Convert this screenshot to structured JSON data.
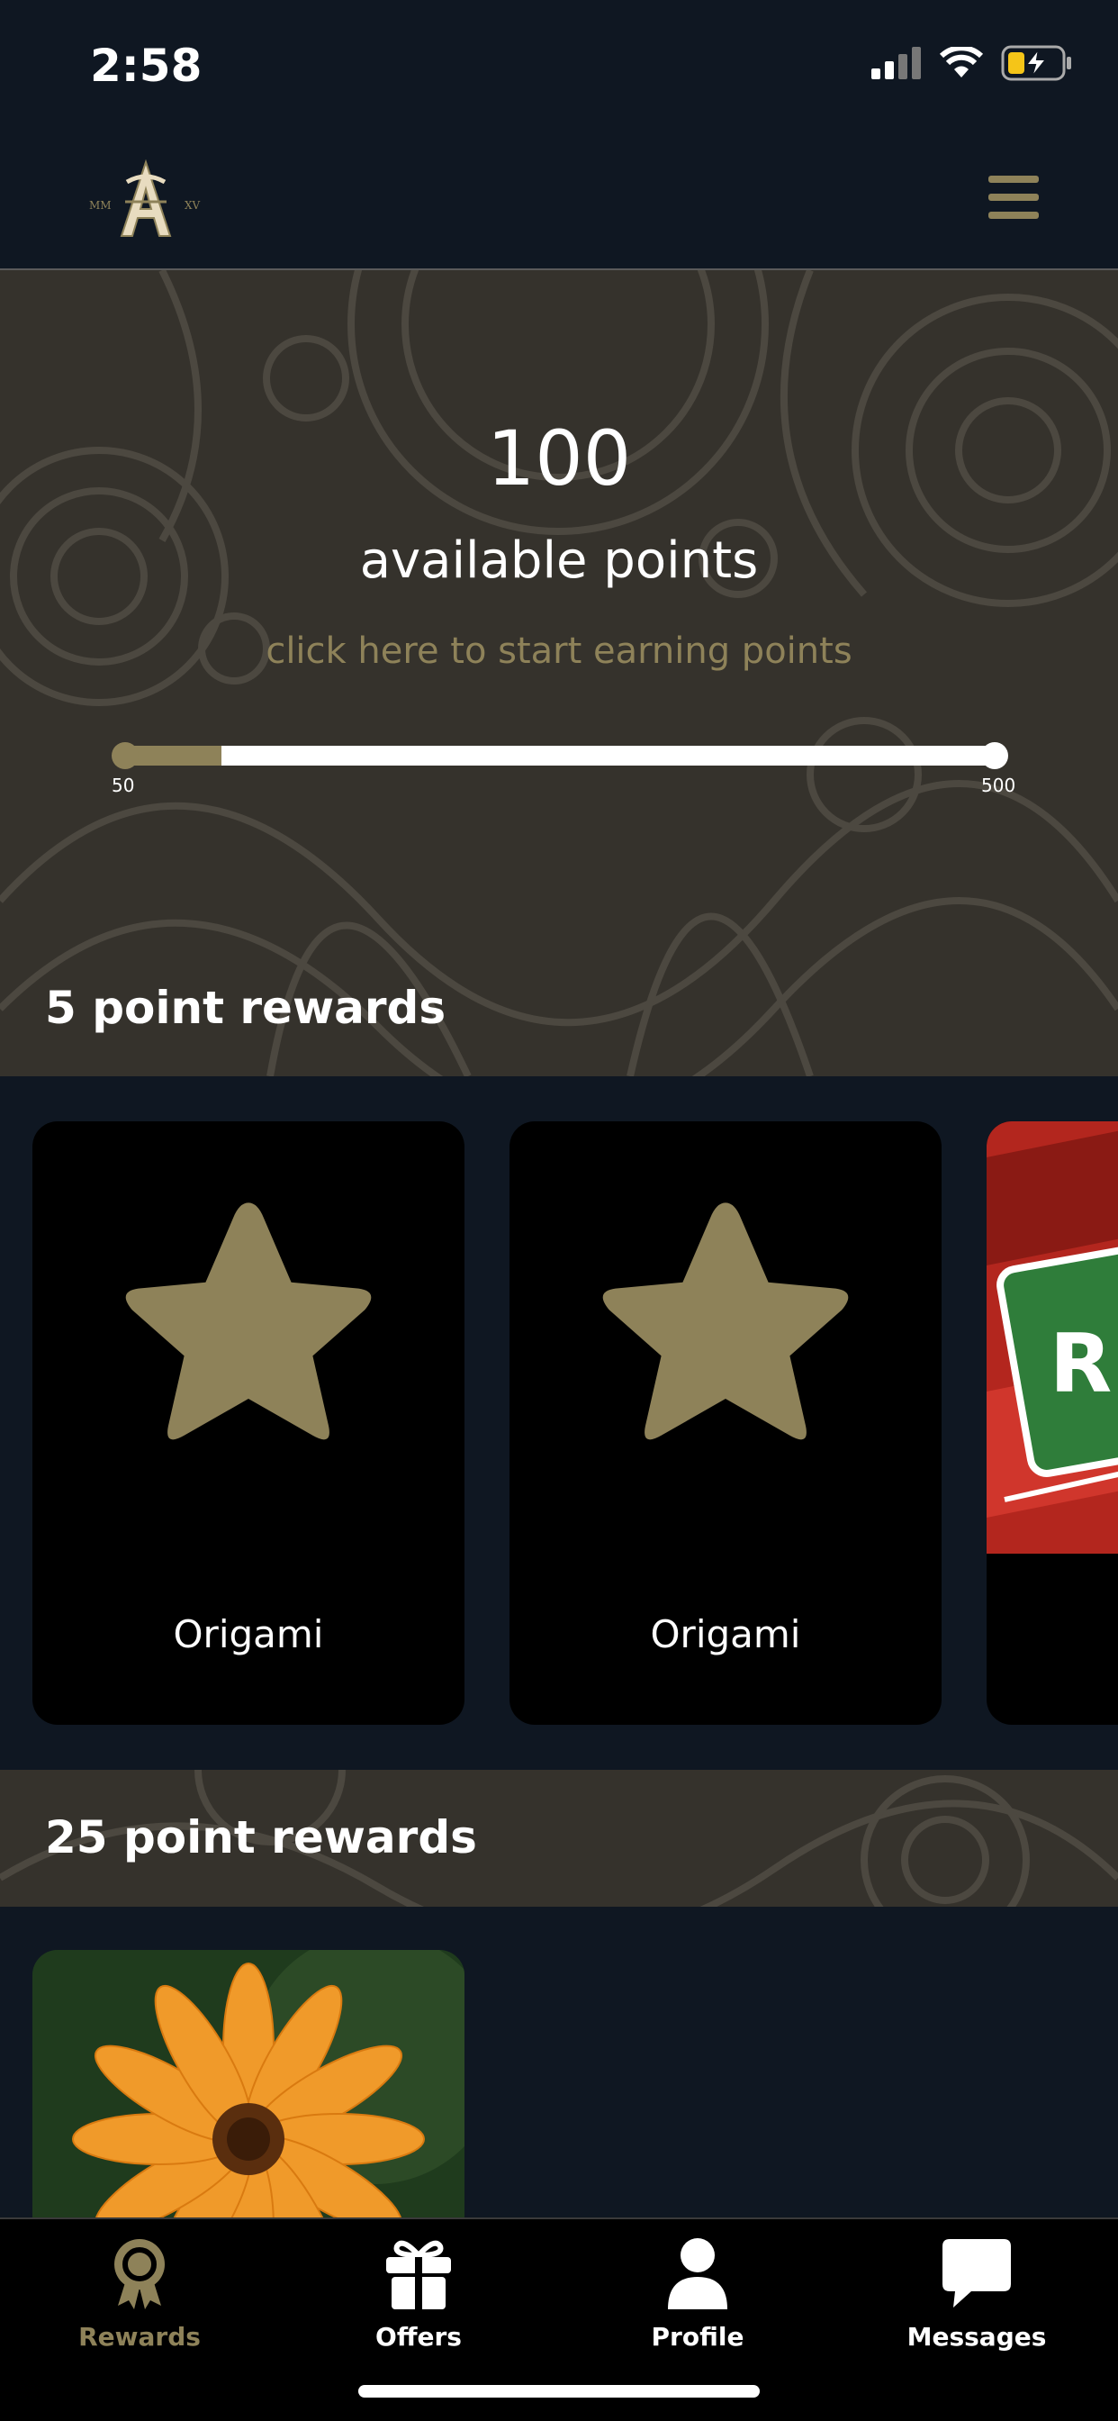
{
  "status": {
    "time": "2:58"
  },
  "header": {
    "logo_icon": "monogram-logo-icon",
    "menu_icon": "hamburger-icon"
  },
  "hero": {
    "points": "100",
    "points_label": "available points",
    "earn_link": "click here to start earning points",
    "progress": {
      "min_label": "50",
      "max_label": "500",
      "value": 100,
      "min": 50,
      "max": 500
    }
  },
  "sections": [
    {
      "title": "5 point rewards",
      "cards": [
        {
          "label": "Origami",
          "icon": "star-icon"
        },
        {
          "label": "Origami",
          "icon": "star-icon"
        },
        {
          "label": "",
          "icon": "cash-image"
        }
      ]
    },
    {
      "title": "25 point rewards",
      "cards": [
        {
          "label": "",
          "icon": "flower-image"
        }
      ]
    }
  ],
  "tabs": [
    {
      "label": "Rewards",
      "icon": "award-ribbon-icon",
      "active": true
    },
    {
      "label": "Offers",
      "icon": "gift-icon",
      "active": false
    },
    {
      "label": "Profile",
      "icon": "person-icon",
      "active": false
    },
    {
      "label": "Messages",
      "icon": "chat-bubble-icon",
      "active": false
    }
  ],
  "colors": {
    "accent": "#8e8259",
    "background": "#0f1722",
    "pattern": "#35322c",
    "card": "#000000"
  }
}
